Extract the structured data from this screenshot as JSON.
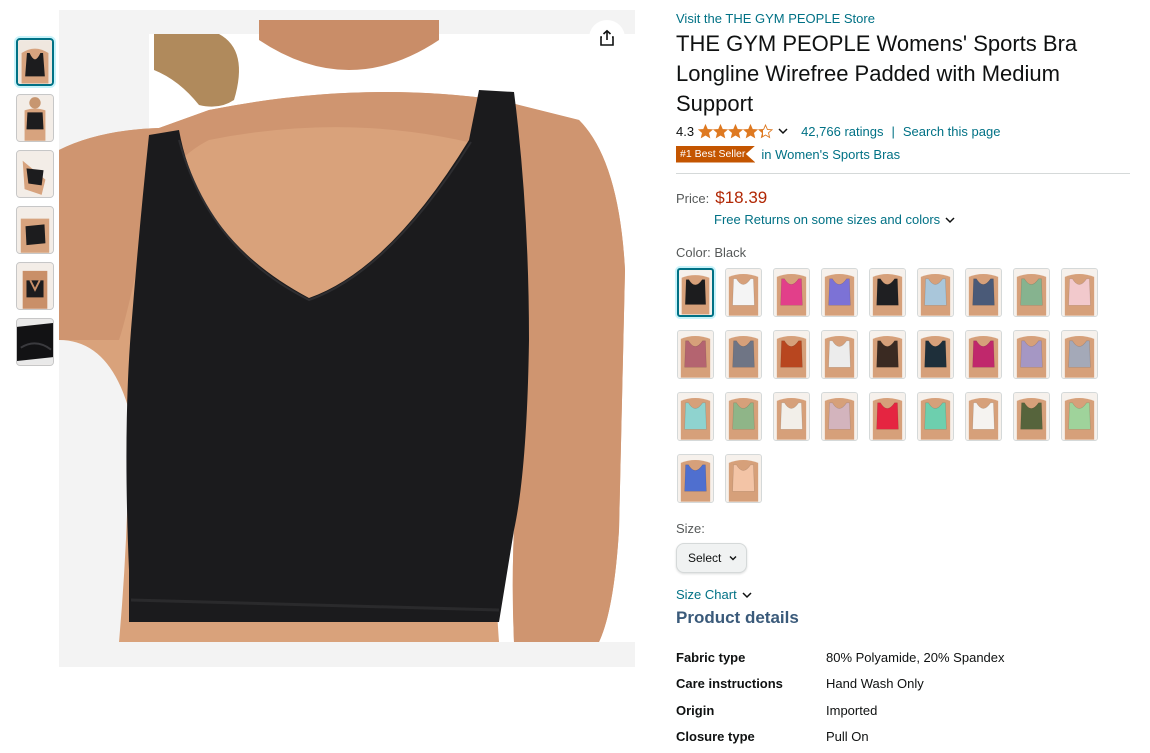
{
  "store": {
    "link_text": "Visit the THE GYM PEOPLE Store"
  },
  "product": {
    "title": "THE GYM PEOPLE Womens' Sports Bra Longline Wirefree Padded with Medium Support",
    "rating": "4.3",
    "stars_value": 4.3,
    "ratings_count": "42,766 ratings",
    "search_link": "Search this page",
    "rating_separator": "|",
    "best_seller_badge": "#1 Best Seller",
    "best_seller_category": "in Women's Sports Bras"
  },
  "price": {
    "label": "Price:",
    "value": "$18.39",
    "returns_text": "Free Returns on some sizes and colors"
  },
  "color": {
    "label": "Color:",
    "selected": "Black",
    "swatches": [
      "#1c1c1e",
      "#f4f4f4",
      "#e23f8a",
      "#7c72d6",
      "#1f1f22",
      "#a9c6da",
      "#4a5a78",
      "#86b38f",
      "#f2c9cc",
      "#b46470",
      "#6f7585",
      "#b8461f",
      "#ececec",
      "#3a2a22",
      "#1e2f3a",
      "#c0286c",
      "#a597c4",
      "#a4a9b8",
      "#8fd3cf",
      "#8fb588",
      "#f2efe9",
      "#d3b4bd",
      "#e52541",
      "#6dcfae",
      "#f5f3f0",
      "#56643c",
      "#9fd39b",
      "#4f6fcf",
      "#f3c4a6"
    ]
  },
  "size": {
    "label": "Size:",
    "select_value": "Select",
    "chart_link": "Size Chart"
  },
  "details": {
    "heading": "Product details",
    "rows": [
      {
        "key": "Fabric type",
        "value": "80% Polyamide, 20% Spandex"
      },
      {
        "key": "Care instructions",
        "value": "Hand Wash Only"
      },
      {
        "key": "Origin",
        "value": "Imported"
      },
      {
        "key": "Closure type",
        "value": "Pull On"
      }
    ]
  },
  "thumbnails": [
    {
      "icon": "front-view-thumbnail"
    },
    {
      "icon": "front-full-thumbnail"
    },
    {
      "icon": "side-view-thumbnail"
    },
    {
      "icon": "angle-view-thumbnail"
    },
    {
      "icon": "back-view-thumbnail"
    },
    {
      "icon": "fabric-detail-thumbnail"
    }
  ],
  "colors": {
    "link": "#007185",
    "price": "#b12704",
    "badge": "#c45500",
    "star": "#de7921",
    "heading": "#3a5a7a"
  }
}
